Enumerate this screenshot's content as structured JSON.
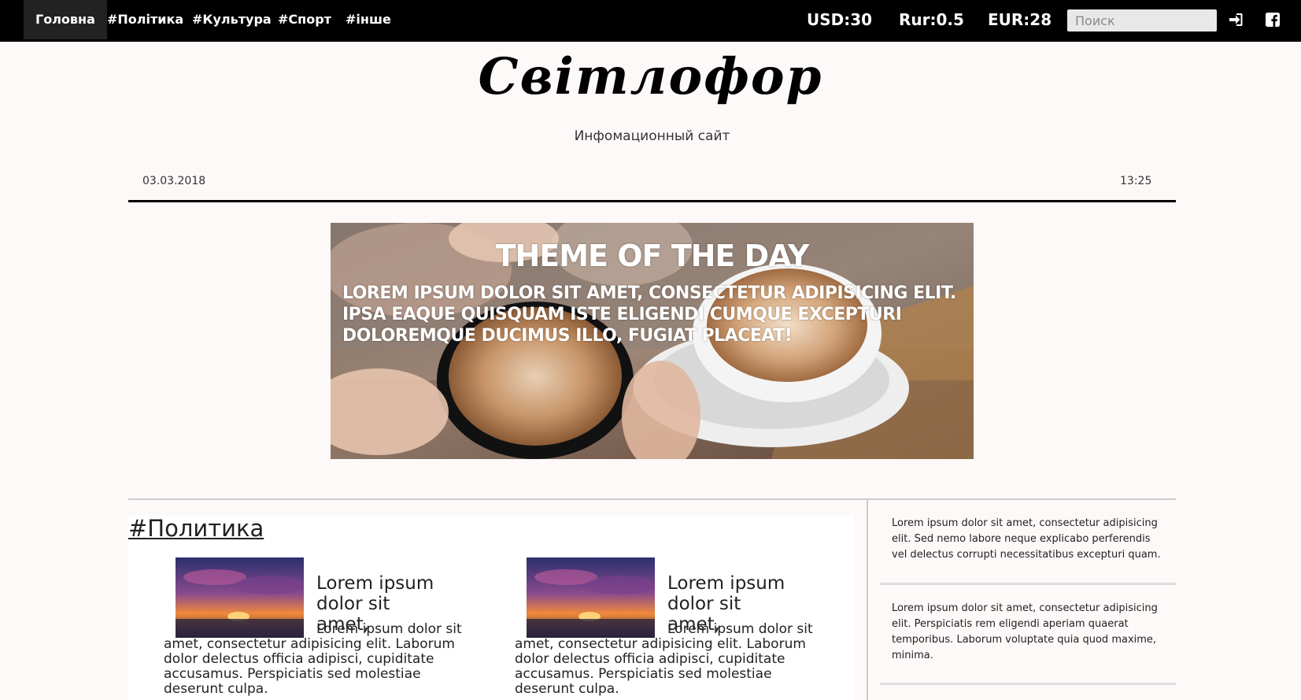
{
  "nav": {
    "items": [
      {
        "label": "Головна",
        "active": true
      },
      {
        "label": "#Політика",
        "active": false
      },
      {
        "label": "#Культура",
        "active": false
      },
      {
        "label": "#Спорт",
        "active": false
      },
      {
        "label": "#інше",
        "active": false
      }
    ],
    "rates": [
      "USD:30",
      "Rur:0.5",
      "EUR:28"
    ],
    "search_placeholder": "Поиск",
    "login_icon": "sign-in-icon",
    "facebook_icon": "facebook-icon"
  },
  "header": {
    "logo": "Світлофор",
    "subtitle": "Инфомационный сайт",
    "date": "03.03.2018",
    "time": "13:25"
  },
  "hero": {
    "title": "THEME OF THE DAY",
    "text": "LOREM IPSUM DOLOR SIT AMET, CONSECTETUR ADIPISICING ELIT. IPSA EAQUE QUISQUAM ISTE ELIGENDI CUMQUE EXCEPTURI DOLOREMQUE DUCIMUS ILLO, FUGIAT PLACEAT!"
  },
  "section": {
    "title": "#Политика",
    "articles": [
      {
        "title": "Lorem ipsum dolor sit amet,",
        "body": "Lorem ipsum dolor sit amet, consectetur adipisicing elit. Laborum dolor delectus officia adipisci, cupiditate accusamus. Perspiciatis sed molestiae deserunt culpa."
      },
      {
        "title": "Lorem ipsum dolor sit amet,",
        "body": "Lorem ipsum dolor sit amet, consectetur adipisicing elit. Laborum dolor delectus officia adipisci, cupiditate accusamus. Perspiciatis sed molestiae deserunt culpa."
      }
    ]
  },
  "sidebar": {
    "items": [
      "Lorem ipsum dolor sit amet, consectetur adipisicing elit. Sed nemo labore neque explicabo perferendis vel delectus corrupti necessitatibus excepturi quam.",
      "Lorem ipsum dolor sit amet, consectetur adipisicing elit. Perspiciatis rem eligendi aperiam quaerat temporibus. Laborum voluptate quia quod maxime, minima."
    ]
  }
}
